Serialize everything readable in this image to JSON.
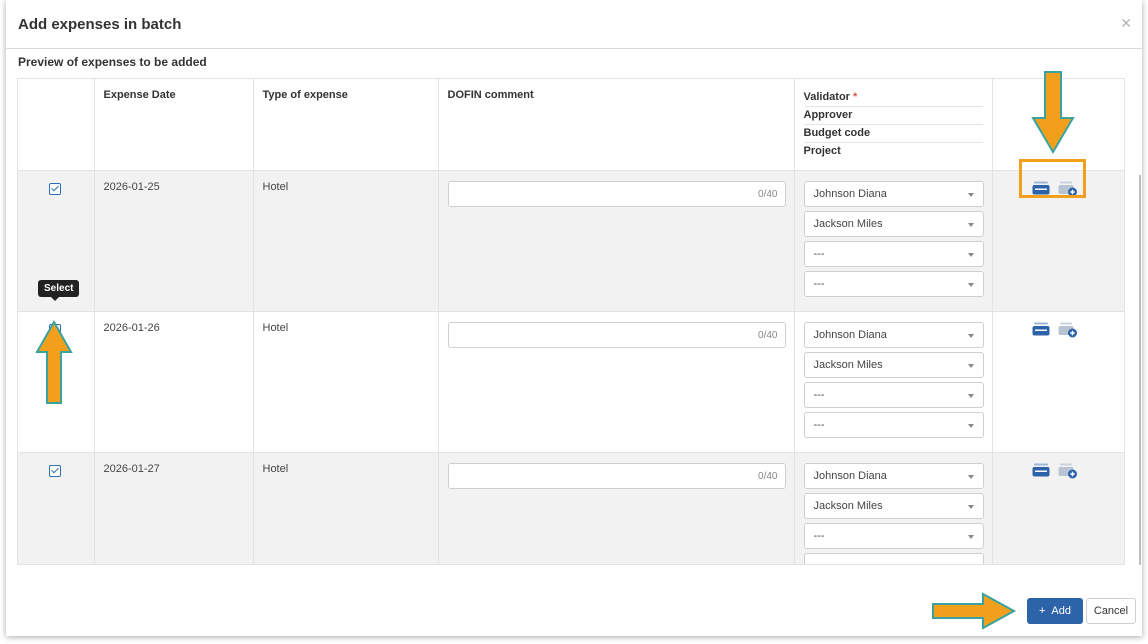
{
  "dialog": {
    "title": "Add expenses in batch",
    "close_icon": "close-icon",
    "section_title": "Preview of expenses to be added"
  },
  "columns": {
    "expense_date": "Expense Date",
    "type_of_expense": "Type of expense",
    "dofin_comment": "DOFIN comment",
    "validator": "Validator",
    "validator_required_mark": "*",
    "approver": "Approver",
    "budget_code": "Budget code",
    "project": "Project"
  },
  "rows": [
    {
      "checked": true,
      "date": "2026-01-25",
      "type": "Hotel",
      "comment_value": "",
      "comment_counter": "0/40",
      "validator": "Johnson Diana",
      "approver": "Jackson Miles",
      "budget_code": "---",
      "project": "---"
    },
    {
      "checked": false,
      "date": "2026-01-26",
      "type": "Hotel",
      "comment_value": "",
      "comment_counter": "0/40",
      "validator": "Johnson Diana",
      "approver": "Jackson Miles",
      "budget_code": "---",
      "project": "---"
    },
    {
      "checked": true,
      "date": "2026-01-27",
      "type": "Hotel",
      "comment_value": "",
      "comment_counter": "0/40",
      "validator": "Johnson Diana",
      "approver": "Jackson Miles",
      "budget_code": "---",
      "project": "---"
    }
  ],
  "row_icons": [
    "copy-row-icon",
    "add-row-icon"
  ],
  "tooltip": {
    "text": "Select"
  },
  "footer": {
    "add_label": "Add",
    "add_icon": "plus-icon",
    "cancel_label": "Cancel"
  },
  "colors": {
    "accent": "#2d63a8",
    "annotation_orange": "#f2a01c",
    "annotation_outline": "#3aa3a0"
  }
}
